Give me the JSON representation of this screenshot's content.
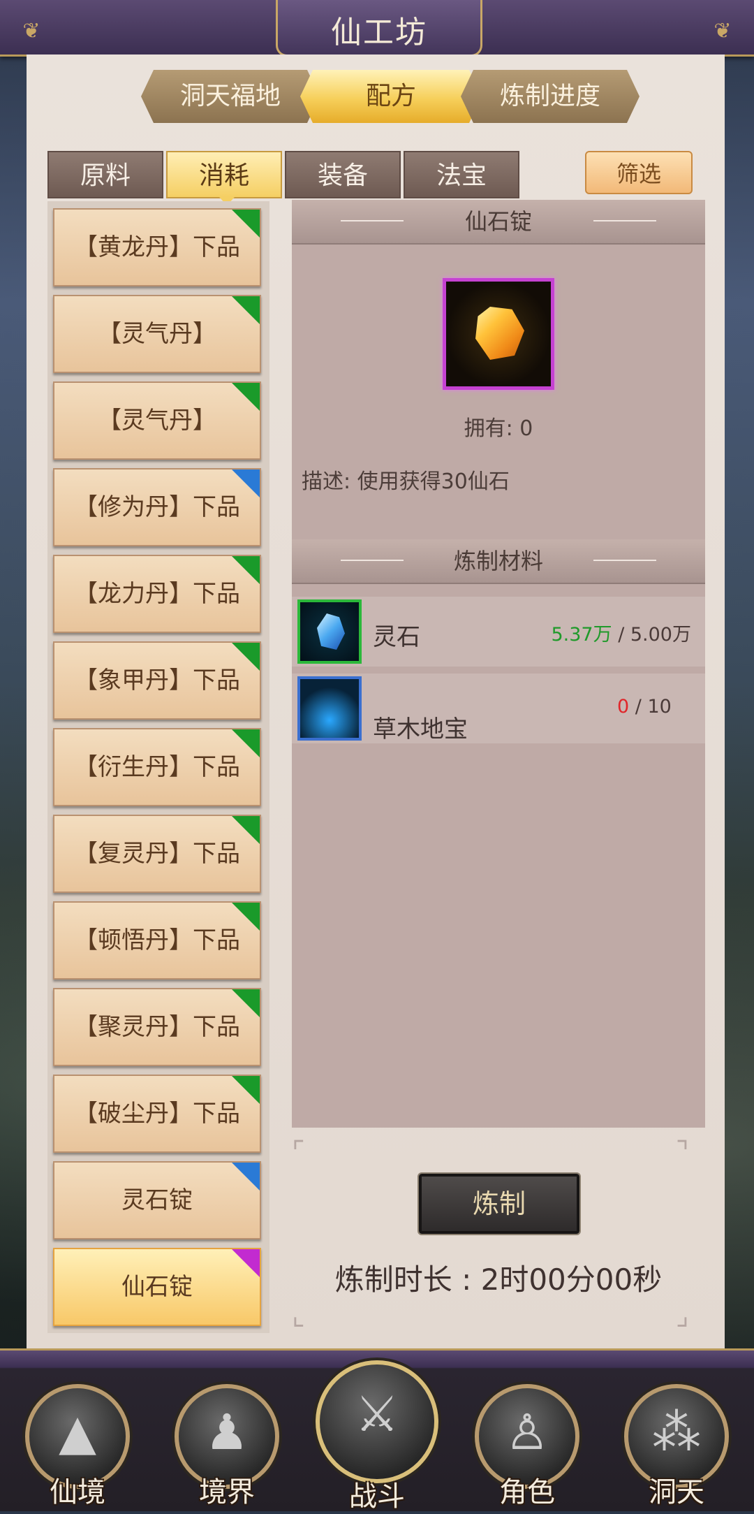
{
  "window": {
    "title": "仙工坊"
  },
  "top_tabs": [
    {
      "label": "洞天福地",
      "active": false
    },
    {
      "label": "配方",
      "active": true
    },
    {
      "label": "炼制进度",
      "active": false
    }
  ],
  "category_tabs": [
    {
      "label": "原料",
      "active": false
    },
    {
      "label": "消耗",
      "active": true
    },
    {
      "label": "装备",
      "active": false
    },
    {
      "label": "法宝",
      "active": false
    }
  ],
  "filter_label": "筛选",
  "items": [
    {
      "label": "【黄龙丹】下品",
      "quality": "green"
    },
    {
      "label": "【灵气丹】",
      "quality": "green"
    },
    {
      "label": "【灵气丹】",
      "quality": "green"
    },
    {
      "label": "【修为丹】下品",
      "quality": "blue"
    },
    {
      "label": "【龙力丹】下品",
      "quality": "green"
    },
    {
      "label": "【象甲丹】下品",
      "quality": "green"
    },
    {
      "label": "【衍生丹】下品",
      "quality": "green"
    },
    {
      "label": "【复灵丹】下品",
      "quality": "green"
    },
    {
      "label": "【顿悟丹】下品",
      "quality": "green"
    },
    {
      "label": "【聚灵丹】下品",
      "quality": "green"
    },
    {
      "label": "【破尘丹】下品",
      "quality": "green"
    },
    {
      "label": "灵石锭",
      "quality": "blue"
    },
    {
      "label": "仙石锭",
      "quality": "purple",
      "selected": true
    }
  ],
  "detail": {
    "name": "仙石锭",
    "owned": "拥有: 0",
    "description": "描述: 使用获得30仙石"
  },
  "materials_header": "炼制材料",
  "materials": [
    {
      "name": "灵石",
      "have": "5.37万",
      "need": " / 5.00万"
    },
    {
      "name": "草木地宝",
      "have": "0",
      "need": " / 10"
    }
  ],
  "craft_button": "炼制",
  "duration": "炼制时长 : 2时00分00秒",
  "nav": [
    "仙境",
    "境界",
    "战斗",
    "角色",
    "洞天"
  ],
  "colors": {
    "quality_green": "#1a9a2a",
    "quality_blue": "#2a7ad6",
    "quality_purple": "#c22bd0",
    "enough": "#1f9a2a",
    "lacking": "#e0262a"
  }
}
